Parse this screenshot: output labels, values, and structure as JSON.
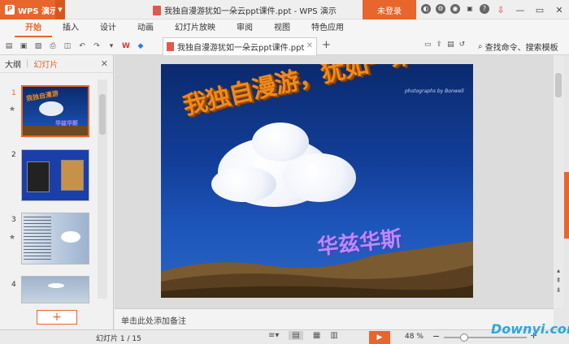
{
  "app": {
    "name": "WPS 演示",
    "window_title": "我独自漫游犹如一朵云ppt课件.ppt - WPS 演示",
    "login": "未登录"
  },
  "tabs": [
    "开始",
    "插入",
    "设计",
    "动画",
    "幻灯片放映",
    "审阅",
    "视图",
    "特色应用"
  ],
  "active_tab": "开始",
  "doc_tab": {
    "name": "我独自漫游犹如一朵云ppt课件.ppt"
  },
  "search_cmd": "查找命令、搜索模板",
  "left_panel": {
    "tab_outline": "大纲",
    "tab_slides": "幻灯片",
    "add_label": "+"
  },
  "slides": [
    {
      "num": "1",
      "star": true
    },
    {
      "num": "2",
      "star": false
    },
    {
      "num": "3",
      "star": true
    },
    {
      "num": "4",
      "star": false
    }
  ],
  "slide": {
    "title": "我独自漫游，犹如一朵云",
    "credit": "photographs by Bonwell",
    "author": "华兹华斯"
  },
  "notes_placeholder": "单击此处添加备注",
  "status": {
    "page": "幻灯片 1 / 15",
    "zoom": "48 %"
  },
  "watermark": "Downyi.com",
  "colors": {
    "accent": "#e8652b",
    "sky": "#13409c",
    "title_orange": "#f08a1a",
    "author_purple": "#b78bff"
  }
}
